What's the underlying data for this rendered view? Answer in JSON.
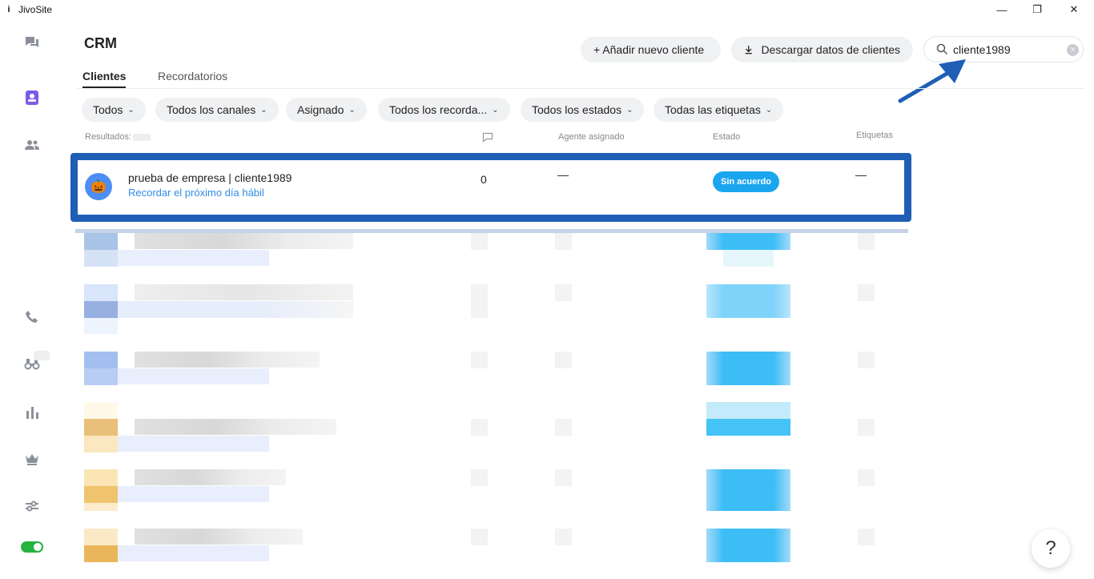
{
  "window": {
    "title": "JivoSite",
    "app_icon": "i",
    "min": "—",
    "max": "❐",
    "close": "✕"
  },
  "header": {
    "title": "CRM",
    "add_button": "+ Añadir nuevo cliente",
    "download_button": "Descargar datos de clientes",
    "search_value": "cliente1989",
    "clear_icon": "×"
  },
  "tabs": [
    {
      "label": "Clientes"
    },
    {
      "label": "Recordatorios"
    }
  ],
  "filters": [
    {
      "label": "Todos"
    },
    {
      "label": "Todos los canales"
    },
    {
      "label": "Asignado"
    },
    {
      "label": "Todos los recorda..."
    },
    {
      "label": "Todos los estados"
    },
    {
      "label": "Todas las etiquetas"
    }
  ],
  "columns": {
    "results": "Resultados:",
    "agent": "Agente asignado",
    "status": "Estado",
    "tags": "Etiquetas"
  },
  "row": {
    "avatar": "🎃",
    "name": "prueba de empresa | cliente1989",
    "reminder": "Recordar el próximo día hábil",
    "count": "0",
    "agent": "—",
    "status": "Sin acuerdo",
    "tags": "—"
  },
  "help": "?",
  "colors": {
    "accent_blue": "#1f5eb5",
    "status_blue": "#1aa6ee",
    "toggle_green": "#25b33f",
    "link_blue": "#2f8de4"
  }
}
